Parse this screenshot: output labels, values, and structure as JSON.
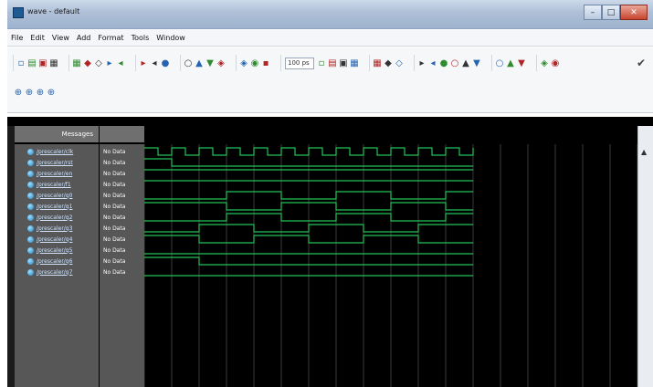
{
  "window": {
    "title": "wave - default"
  },
  "menu": [
    "File",
    "Edit",
    "View",
    "Add",
    "Format",
    "Tools",
    "Window"
  ],
  "toolbar": {
    "row1": [
      {
        "icons": [
          "new-icon",
          "open-icon",
          "save-icon",
          "print-icon"
        ]
      },
      {
        "icons": [
          "cut-icon",
          "copy-icon",
          "paste-icon",
          "undo-icon",
          "redo-icon"
        ]
      },
      {
        "icons": [
          "find-icon",
          "bookmark-icon",
          "sort-icon"
        ]
      },
      {
        "icons": [
          "zoom-fit-icon",
          "zoom-in-icon",
          "zoom-out-icon",
          "zoom-area-icon"
        ]
      },
      {
        "icons": [
          "step-icon",
          "run-icon",
          "continue-icon"
        ]
      },
      {
        "field": "100 ps",
        "icons": [
          "run-length-icon",
          "restart-icon",
          "break-icon",
          "stop-icon"
        ]
      },
      {
        "icons": [
          "wave-a-icon",
          "wave-b-icon",
          "wave-c-icon"
        ]
      },
      {
        "icons": [
          "marker-a-icon",
          "marker-b-icon",
          "cursor-add-icon",
          "cursor-del-icon",
          "cursor-next-icon",
          "cursor-prev-icon"
        ]
      },
      {
        "icons": [
          "select-icon",
          "edit-icon",
          "expand-icon"
        ]
      },
      {
        "icons": [
          "collapse-icon",
          "dataflow-icon"
        ]
      }
    ],
    "row2": [
      "zoom-in-icon",
      "zoom-out-icon",
      "zoom-full-icon",
      "zoom-cursor-icon"
    ]
  },
  "wave": {
    "name_header": "Messages",
    "time_ticks": 12,
    "signals": [
      {
        "name": "/prescaler/clk",
        "value": "No Data",
        "type": "clock",
        "period": 2
      },
      {
        "name": "/prescaler/rst",
        "value": "No Data",
        "type": "step",
        "toggles": [
          1
        ],
        "start": 1
      },
      {
        "name": "/prescaler/en",
        "value": "No Data",
        "type": "const",
        "level": 1
      },
      {
        "name": "/prescaler/f1",
        "value": "No Data",
        "type": "const",
        "level": 1
      },
      {
        "name": "/prescaler/q0",
        "value": "No Data",
        "type": "pattern",
        "start": 0,
        "toggles": [
          3,
          5,
          7,
          9,
          11
        ]
      },
      {
        "name": "/prescaler/q1",
        "value": "No Data",
        "type": "pattern",
        "start": 1,
        "toggles": [
          3,
          5,
          7,
          9,
          11
        ]
      },
      {
        "name": "/prescaler/q2",
        "value": "No Data",
        "type": "pattern",
        "start": 0,
        "toggles": [
          3,
          5,
          7,
          9,
          11
        ]
      },
      {
        "name": "/prescaler/q3",
        "value": "No Data",
        "type": "pattern",
        "start": 0,
        "toggles": [
          2,
          4,
          6,
          8,
          10
        ]
      },
      {
        "name": "/prescaler/q4",
        "value": "No Data",
        "type": "pattern",
        "start": 1,
        "toggles": [
          2,
          4,
          6,
          8,
          10
        ]
      },
      {
        "name": "/prescaler/q5",
        "value": "No Data",
        "type": "const",
        "level": 0
      },
      {
        "name": "/prescaler/q6",
        "value": "No Data",
        "type": "step",
        "toggles": [
          2
        ],
        "start": 1
      },
      {
        "name": "/prescaler/q7",
        "value": "No Data",
        "type": "const",
        "level": 0
      }
    ]
  },
  "colors": {
    "wave": "#22c455",
    "grid": "#3a3a3a",
    "background": "#000000"
  }
}
